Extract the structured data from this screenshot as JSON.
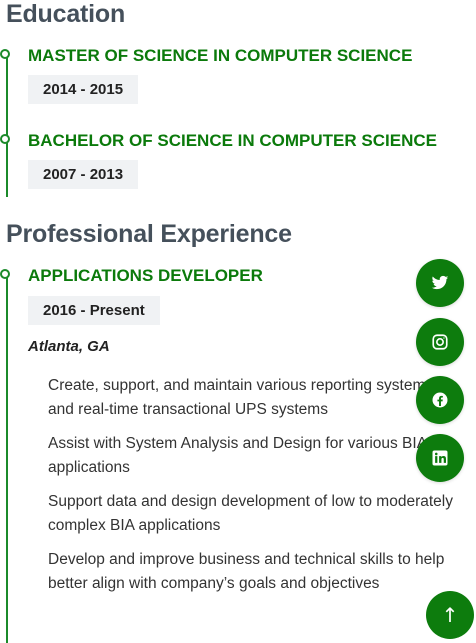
{
  "education": {
    "heading": "Education",
    "items": [
      {
        "title": "MASTER OF SCIENCE IN COMPUTER SCIENCE",
        "dates": "2014 - 2015"
      },
      {
        "title": "BACHELOR OF SCIENCE IN COMPUTER SCIENCE",
        "dates": "2007 - 2013"
      }
    ]
  },
  "experience": {
    "heading": "Professional Experience",
    "items": [
      {
        "title": "APPLICATIONS DEVELOPER",
        "dates": "2016 - Present",
        "location": "Atlanta, GA",
        "bullets": [
          "Create, support, and maintain various reporting systems and real-time transactional UPS systems",
          "Assist with System Analysis and Design for various BIA applications",
          "Support data and design development of low to moderately complex BIA applications",
          "Develop and improve business and technical skills to help better align with company’s goals and objectives"
        ]
      }
    ]
  },
  "social": [
    {
      "icon": "twitter-icon"
    },
    {
      "icon": "instagram-icon"
    },
    {
      "icon": "facebook-icon"
    },
    {
      "icon": "linkedin-icon"
    }
  ],
  "back_to_top": {
    "icon": "arrow-up-icon",
    "glyph": "↑"
  },
  "colors": {
    "accent": "#0d7c0d",
    "heading": "#45505b",
    "date_bg": "#f0f2f4"
  }
}
